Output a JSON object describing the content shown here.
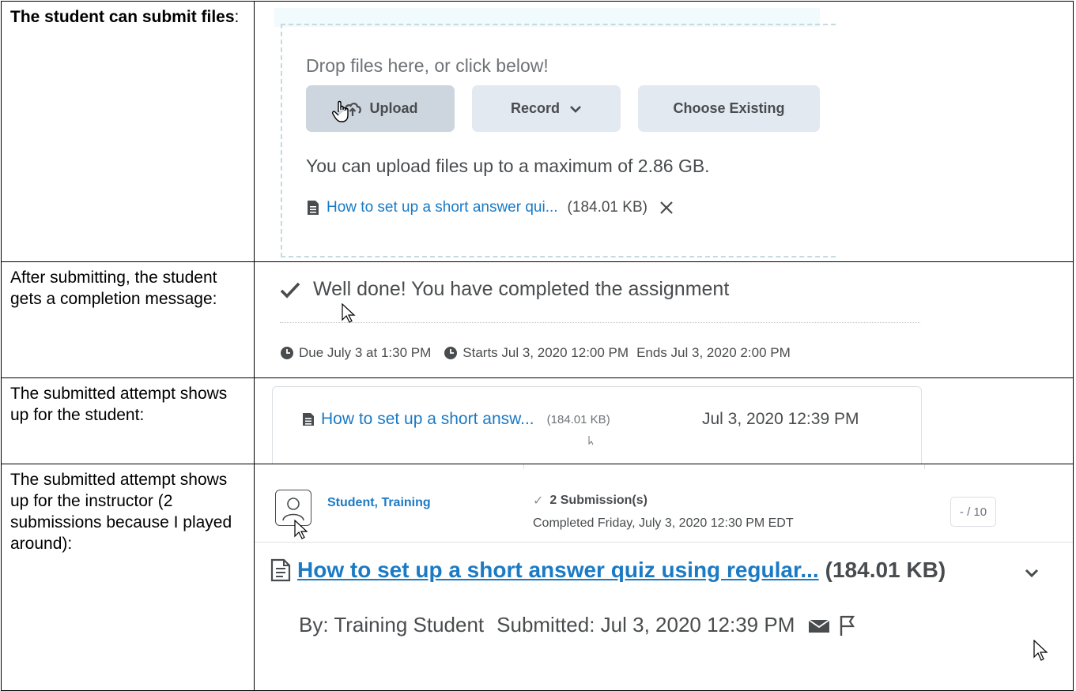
{
  "rows": [
    {
      "label_bold": "The student can submit files",
      "label_rest": ":"
    },
    {
      "label": "After submitting, the student gets a completion message:"
    },
    {
      "label": "The submitted attempt shows up for the student:"
    },
    {
      "label": "The submitted attempt shows up for the instructor (2 submissions because I played around):"
    }
  ],
  "dropzone": {
    "title": "Drop files here, or click below!",
    "buttons": {
      "upload": "Upload",
      "record": "Record",
      "choose": "Choose Existing"
    },
    "limit_text": "You can upload files up to a maximum of 2.86 GB.",
    "file": {
      "name": "How to set up a short answer qui...",
      "size": "(184.01 KB)"
    }
  },
  "completion": {
    "message": "Well done! You have completed the assignment",
    "due": "Due July 3 at 1:30 PM",
    "starts": "Starts Jul 3, 2020 12:00 PM",
    "ends": "Ends Jul 3, 2020 2:00 PM"
  },
  "student_attempt": {
    "file_name": "How to set up a short answ...",
    "file_size": "(184.01 KB)",
    "date": "Jul 3, 2020 12:39 PM"
  },
  "instructor": {
    "student_name": "Student, Training",
    "submissions": "2 Submission(s)",
    "completed": "Completed Friday, July 3, 2020 12:30 PM EDT",
    "score": "- / 10",
    "submission_file": "How to set up a short answer quiz using regular...",
    "submission_size": "(184.01 KB)",
    "by": "By: Training Student",
    "submitted": "Submitted: Jul 3, 2020 12:39 PM"
  },
  "colors": {
    "link": "#1a7ac5",
    "text_gray": "#494c4e",
    "button_bg": "#e3e9f1",
    "upload_bg": "#cdd5de"
  }
}
